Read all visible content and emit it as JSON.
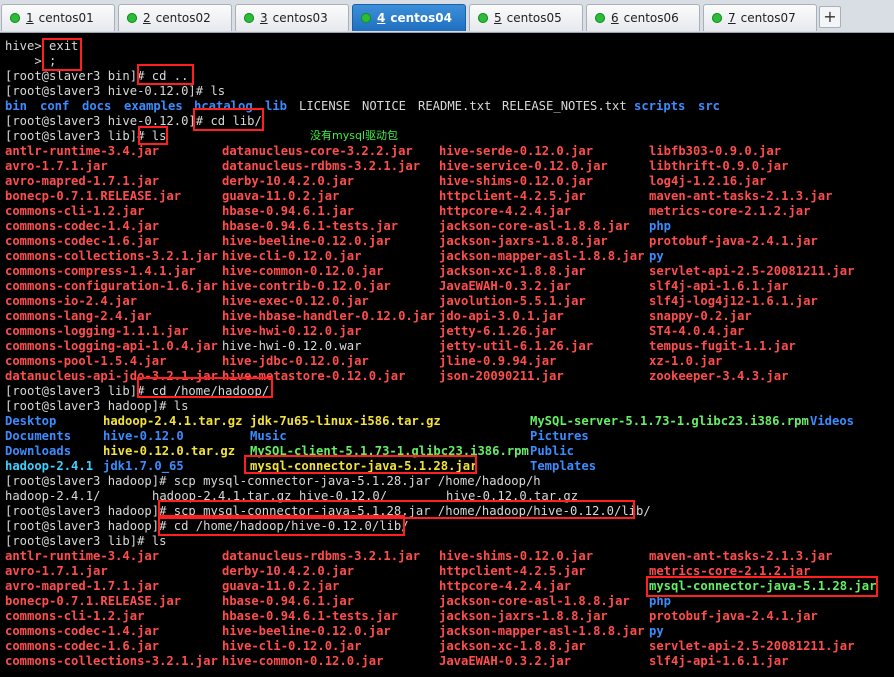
{
  "tabs": [
    {
      "num": "1",
      "label": "centos01",
      "active": false
    },
    {
      "num": "2",
      "label": "centos02",
      "active": false
    },
    {
      "num": "3",
      "label": "centos03",
      "active": false
    },
    {
      "num": "4",
      "label": "centos04",
      "active": true
    },
    {
      "num": "5",
      "label": "centos05",
      "active": false
    },
    {
      "num": "6",
      "label": "centos06",
      "active": false
    },
    {
      "num": "7",
      "label": "centos07",
      "active": false
    }
  ],
  "add_tab": "+",
  "annotation": "没有mysql驱动包",
  "colors": {
    "red": "#ff4d4d",
    "blue": "#3c8cff",
    "green": "#64f064",
    "yellow": "#f2e23c",
    "cyan": "#3fd0ff",
    "highlight": "#ff1f1f"
  },
  "lines": [
    [
      [
        "w",
        "hive> exit"
      ]
    ],
    [
      [
        "w",
        "    > ;"
      ]
    ],
    [
      [
        "w",
        "[root@slaver3 bin]# cd .."
      ]
    ],
    [
      [
        "w",
        "[root@slaver3 hive-0.12.0]# ls"
      ]
    ],
    [
      [
        "b",
        "bin"
      ],
      [
        "b",
        "conf"
      ],
      [
        "b",
        "docs"
      ],
      [
        "b",
        "examples"
      ],
      [
        "b",
        "hcatalog"
      ],
      [
        "b",
        "lib"
      ],
      [
        "w",
        "LICENSE"
      ],
      [
        "w",
        "NOTICE"
      ],
      [
        "w",
        "README.txt"
      ],
      [
        "w",
        "RELEASE_NOTES.txt"
      ],
      [
        "b",
        "scripts"
      ],
      [
        "b",
        "src"
      ]
    ],
    [
      [
        "w",
        "[root@slaver3 hive-0.12.0]# cd lib/"
      ]
    ],
    [
      [
        "w",
        "[root@slaver3 lib]# ls"
      ]
    ],
    [
      [
        "r",
        "antlr-runtime-3.4.jar"
      ],
      [
        "r",
        "datanucleus-core-3.2.2.jar"
      ],
      [
        "r",
        "hive-serde-0.12.0.jar"
      ],
      [
        "r",
        "libfb303-0.9.0.jar"
      ]
    ],
    [
      [
        "r",
        "avro-1.7.1.jar"
      ],
      [
        "r",
        "datanucleus-rdbms-3.2.1.jar"
      ],
      [
        "r",
        "hive-service-0.12.0.jar"
      ],
      [
        "r",
        "libthrift-0.9.0.jar"
      ]
    ],
    [
      [
        "r",
        "avro-mapred-1.7.1.jar"
      ],
      [
        "r",
        "derby-10.4.2.0.jar"
      ],
      [
        "r",
        "hive-shims-0.12.0.jar"
      ],
      [
        "r",
        "log4j-1.2.16.jar"
      ]
    ],
    [
      [
        "r",
        "bonecp-0.7.1.RELEASE.jar"
      ],
      [
        "r",
        "guava-11.0.2.jar"
      ],
      [
        "r",
        "httpclient-4.2.5.jar"
      ],
      [
        "r",
        "maven-ant-tasks-2.1.3.jar"
      ]
    ],
    [
      [
        "r",
        "commons-cli-1.2.jar"
      ],
      [
        "r",
        "hbase-0.94.6.1.jar"
      ],
      [
        "r",
        "httpcore-4.2.4.jar"
      ],
      [
        "r",
        "metrics-core-2.1.2.jar"
      ]
    ],
    [
      [
        "r",
        "commons-codec-1.4.jar"
      ],
      [
        "r",
        "hbase-0.94.6.1-tests.jar"
      ],
      [
        "r",
        "jackson-core-asl-1.8.8.jar"
      ],
      [
        "b",
        "php"
      ]
    ],
    [
      [
        "r",
        "commons-codec-1.6.jar"
      ],
      [
        "r",
        "hive-beeline-0.12.0.jar"
      ],
      [
        "r",
        "jackson-jaxrs-1.8.8.jar"
      ],
      [
        "r",
        "protobuf-java-2.4.1.jar"
      ]
    ],
    [
      [
        "r",
        "commons-collections-3.2.1.jar"
      ],
      [
        "r",
        "hive-cli-0.12.0.jar"
      ],
      [
        "r",
        "jackson-mapper-asl-1.8.8.jar"
      ],
      [
        "b",
        "py"
      ]
    ],
    [
      [
        "r",
        "commons-compress-1.4.1.jar"
      ],
      [
        "r",
        "hive-common-0.12.0.jar"
      ],
      [
        "r",
        "jackson-xc-1.8.8.jar"
      ],
      [
        "r",
        "servlet-api-2.5-20081211.jar"
      ]
    ],
    [
      [
        "r",
        "commons-configuration-1.6.jar"
      ],
      [
        "r",
        "hive-contrib-0.12.0.jar"
      ],
      [
        "r",
        "JavaEWAH-0.3.2.jar"
      ],
      [
        "r",
        "slf4j-api-1.6.1.jar"
      ]
    ],
    [
      [
        "r",
        "commons-io-2.4.jar"
      ],
      [
        "r",
        "hive-exec-0.12.0.jar"
      ],
      [
        "r",
        "javolution-5.5.1.jar"
      ],
      [
        "r",
        "slf4j-log4j12-1.6.1.jar"
      ]
    ],
    [
      [
        "r",
        "commons-lang-2.4.jar"
      ],
      [
        "r",
        "hive-hbase-handler-0.12.0.jar"
      ],
      [
        "r",
        "jdo-api-3.0.1.jar"
      ],
      [
        "r",
        "snappy-0.2.jar"
      ]
    ],
    [
      [
        "r",
        "commons-logging-1.1.1.jar"
      ],
      [
        "r",
        "hive-hwi-0.12.0.jar"
      ],
      [
        "r",
        "jetty-6.1.26.jar"
      ],
      [
        "r",
        "ST4-4.0.4.jar"
      ]
    ],
    [
      [
        "r",
        "commons-logging-api-1.0.4.jar"
      ],
      [
        "w",
        "hive-hwi-0.12.0.war"
      ],
      [
        "r",
        "jetty-util-6.1.26.jar"
      ],
      [
        "r",
        "tempus-fugit-1.1.jar"
      ]
    ],
    [
      [
        "r",
        "commons-pool-1.5.4.jar"
      ],
      [
        "r",
        "hive-jdbc-0.12.0.jar"
      ],
      [
        "r",
        "jline-0.9.94.jar"
      ],
      [
        "r",
        "xz-1.0.jar"
      ]
    ],
    [
      [
        "r",
        "datanucleus-api-jdo-3.2.1.jar"
      ],
      [
        "r",
        "hive-metastore-0.12.0.jar"
      ],
      [
        "r",
        "json-20090211.jar"
      ],
      [
        "r",
        "zookeeper-3.4.3.jar"
      ]
    ],
    [
      [
        "w",
        "[root@slaver3 lib]# cd /home/hadoop/"
      ]
    ],
    [
      [
        "w",
        "[root@slaver3 hadoop]# ls"
      ]
    ],
    [
      [
        "b",
        "Desktop"
      ],
      [
        "y",
        "hadoop-2.4.1.tar.gz"
      ],
      [
        "y",
        "jdk-7u65-linux-i586.tar.gz"
      ],
      [
        "g",
        "MySQL-server-5.1.73-1.glibc23.i386.rpm"
      ],
      [
        "b",
        "Videos"
      ]
    ],
    [
      [
        "b",
        "Documents"
      ],
      [
        "b",
        "hive-0.12.0"
      ],
      [
        "b",
        "Music"
      ],
      [
        "b",
        "Pictures"
      ]
    ],
    [
      [
        "b",
        "Downloads"
      ],
      [
        "y",
        "hive-0.12.0.tar.gz"
      ],
      [
        "g",
        "MySQL-client-5.1.73-1.glibc23.i386.rpm"
      ],
      [
        "b",
        "Public"
      ]
    ],
    [
      [
        "cy",
        "hadoop-2.4.1"
      ],
      [
        "b",
        "jdk1.7.0_65"
      ],
      [
        "y",
        "mysql-connector-java-5.1.28.jar"
      ],
      [
        "b",
        "Templates"
      ]
    ],
    [
      [
        "w",
        "[root@slaver3 hadoop]# scp mysql-connector-java-5.1.28.jar /home/hadoop/h"
      ]
    ],
    [
      [
        "w",
        "hadoop-2.4.1/"
      ],
      [
        "w",
        "hadoop-2.4.1.tar.gz"
      ],
      [
        "w",
        "hive-0.12.0/"
      ],
      [
        "w",
        "hive-0.12.0.tar.gz"
      ]
    ],
    [
      [
        "w",
        "[root@slaver3 hadoop]# scp mysql-connector-java-5.1.28.jar /home/hadoop/hive-0.12.0/lib/"
      ]
    ],
    [
      [
        "w",
        "[root@slaver3 hadoop]# cd /home/hadoop/hive-0.12.0/lib/"
      ]
    ],
    [
      [
        "w",
        "[root@slaver3 lib]# ls"
      ]
    ],
    [
      [
        "r",
        "antlr-runtime-3.4.jar"
      ],
      [
        "r",
        "datanucleus-rdbms-3.2.1.jar"
      ],
      [
        "r",
        "hive-shims-0.12.0.jar"
      ],
      [
        "r",
        "maven-ant-tasks-2.1.3.jar"
      ]
    ],
    [
      [
        "r",
        "avro-1.7.1.jar"
      ],
      [
        "r",
        "derby-10.4.2.0.jar"
      ],
      [
        "r",
        "httpclient-4.2.5.jar"
      ],
      [
        "r",
        "metrics-core-2.1.2.jar"
      ]
    ],
    [
      [
        "r",
        "avro-mapred-1.7.1.jar"
      ],
      [
        "r",
        "guava-11.0.2.jar"
      ],
      [
        "r",
        "httpcore-4.2.4.jar"
      ],
      [
        "g",
        "mysql-connector-java-5.1.28.jar"
      ]
    ],
    [
      [
        "r",
        "bonecp-0.7.1.RELEASE.jar"
      ],
      [
        "r",
        "hbase-0.94.6.1.jar"
      ],
      [
        "r",
        "jackson-core-asl-1.8.8.jar"
      ],
      [
        "b",
        "php"
      ]
    ],
    [
      [
        "r",
        "commons-cli-1.2.jar"
      ],
      [
        "r",
        "hbase-0.94.6.1-tests.jar"
      ],
      [
        "r",
        "jackson-jaxrs-1.8.8.jar"
      ],
      [
        "r",
        "protobuf-java-2.4.1.jar"
      ]
    ],
    [
      [
        "r",
        "commons-codec-1.4.jar"
      ],
      [
        "r",
        "hive-beeline-0.12.0.jar"
      ],
      [
        "r",
        "jackson-mapper-asl-1.8.8.jar"
      ],
      [
        "b",
        "py"
      ]
    ],
    [
      [
        "r",
        "commons-codec-1.6.jar"
      ],
      [
        "r",
        "hive-cli-0.12.0.jar"
      ],
      [
        "r",
        "jackson-xc-1.8.8.jar"
      ],
      [
        "r",
        "servlet-api-2.5-20081211.jar"
      ]
    ],
    [
      [
        "r",
        "commons-collections-3.2.1.jar"
      ],
      [
        "r",
        "hive-common-0.12.0.jar"
      ],
      [
        "r",
        "JavaEWAH-0.3.2.jar"
      ],
      [
        "r",
        "slf4j-api-1.6.1.jar"
      ]
    ]
  ]
}
